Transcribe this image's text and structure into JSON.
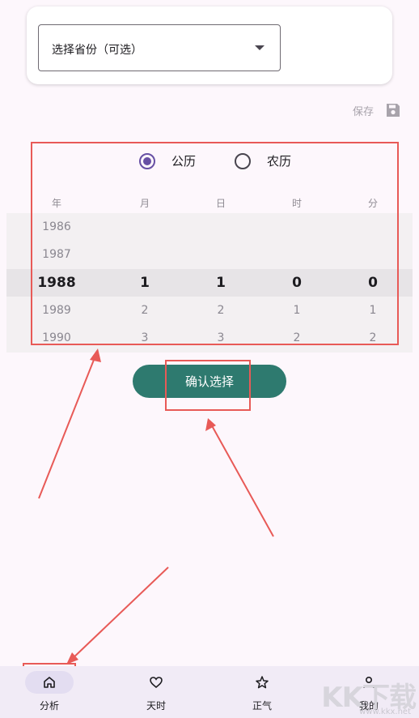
{
  "province_select": {
    "label": "选择省份（可选）"
  },
  "save": {
    "label": "保存",
    "icon": "save-icon"
  },
  "calendar_type": {
    "options": [
      {
        "label": "公历",
        "selected": true
      },
      {
        "label": "农历",
        "selected": false
      }
    ]
  },
  "picker": {
    "headers": [
      "年",
      "月",
      "日",
      "时",
      "分"
    ],
    "columns": {
      "year": [
        "1986",
        "1987",
        "1988",
        "1989",
        "1990"
      ],
      "month": [
        "",
        "",
        "1",
        "2",
        "3"
      ],
      "day": [
        "",
        "",
        "1",
        "2",
        "3"
      ],
      "hour": [
        "",
        "",
        "0",
        "1",
        "2"
      ],
      "minute": [
        "",
        "",
        "0",
        "1",
        "2"
      ]
    }
  },
  "confirm": {
    "label": "确认选择"
  },
  "bottom_nav": {
    "items": [
      {
        "label": "分析",
        "icon": "home-icon",
        "active": true
      },
      {
        "label": "天时",
        "icon": "heart-icon",
        "active": false
      },
      {
        "label": "正气",
        "icon": "star-icon",
        "active": false
      },
      {
        "label": "我的",
        "icon": "person-icon",
        "active": false
      }
    ]
  },
  "watermark": {
    "big": "KK下载",
    "small": "www.kkx.net"
  },
  "colors": {
    "accent": "#6750a4",
    "button": "#2e7a6f",
    "annotation": "#e85a57"
  }
}
